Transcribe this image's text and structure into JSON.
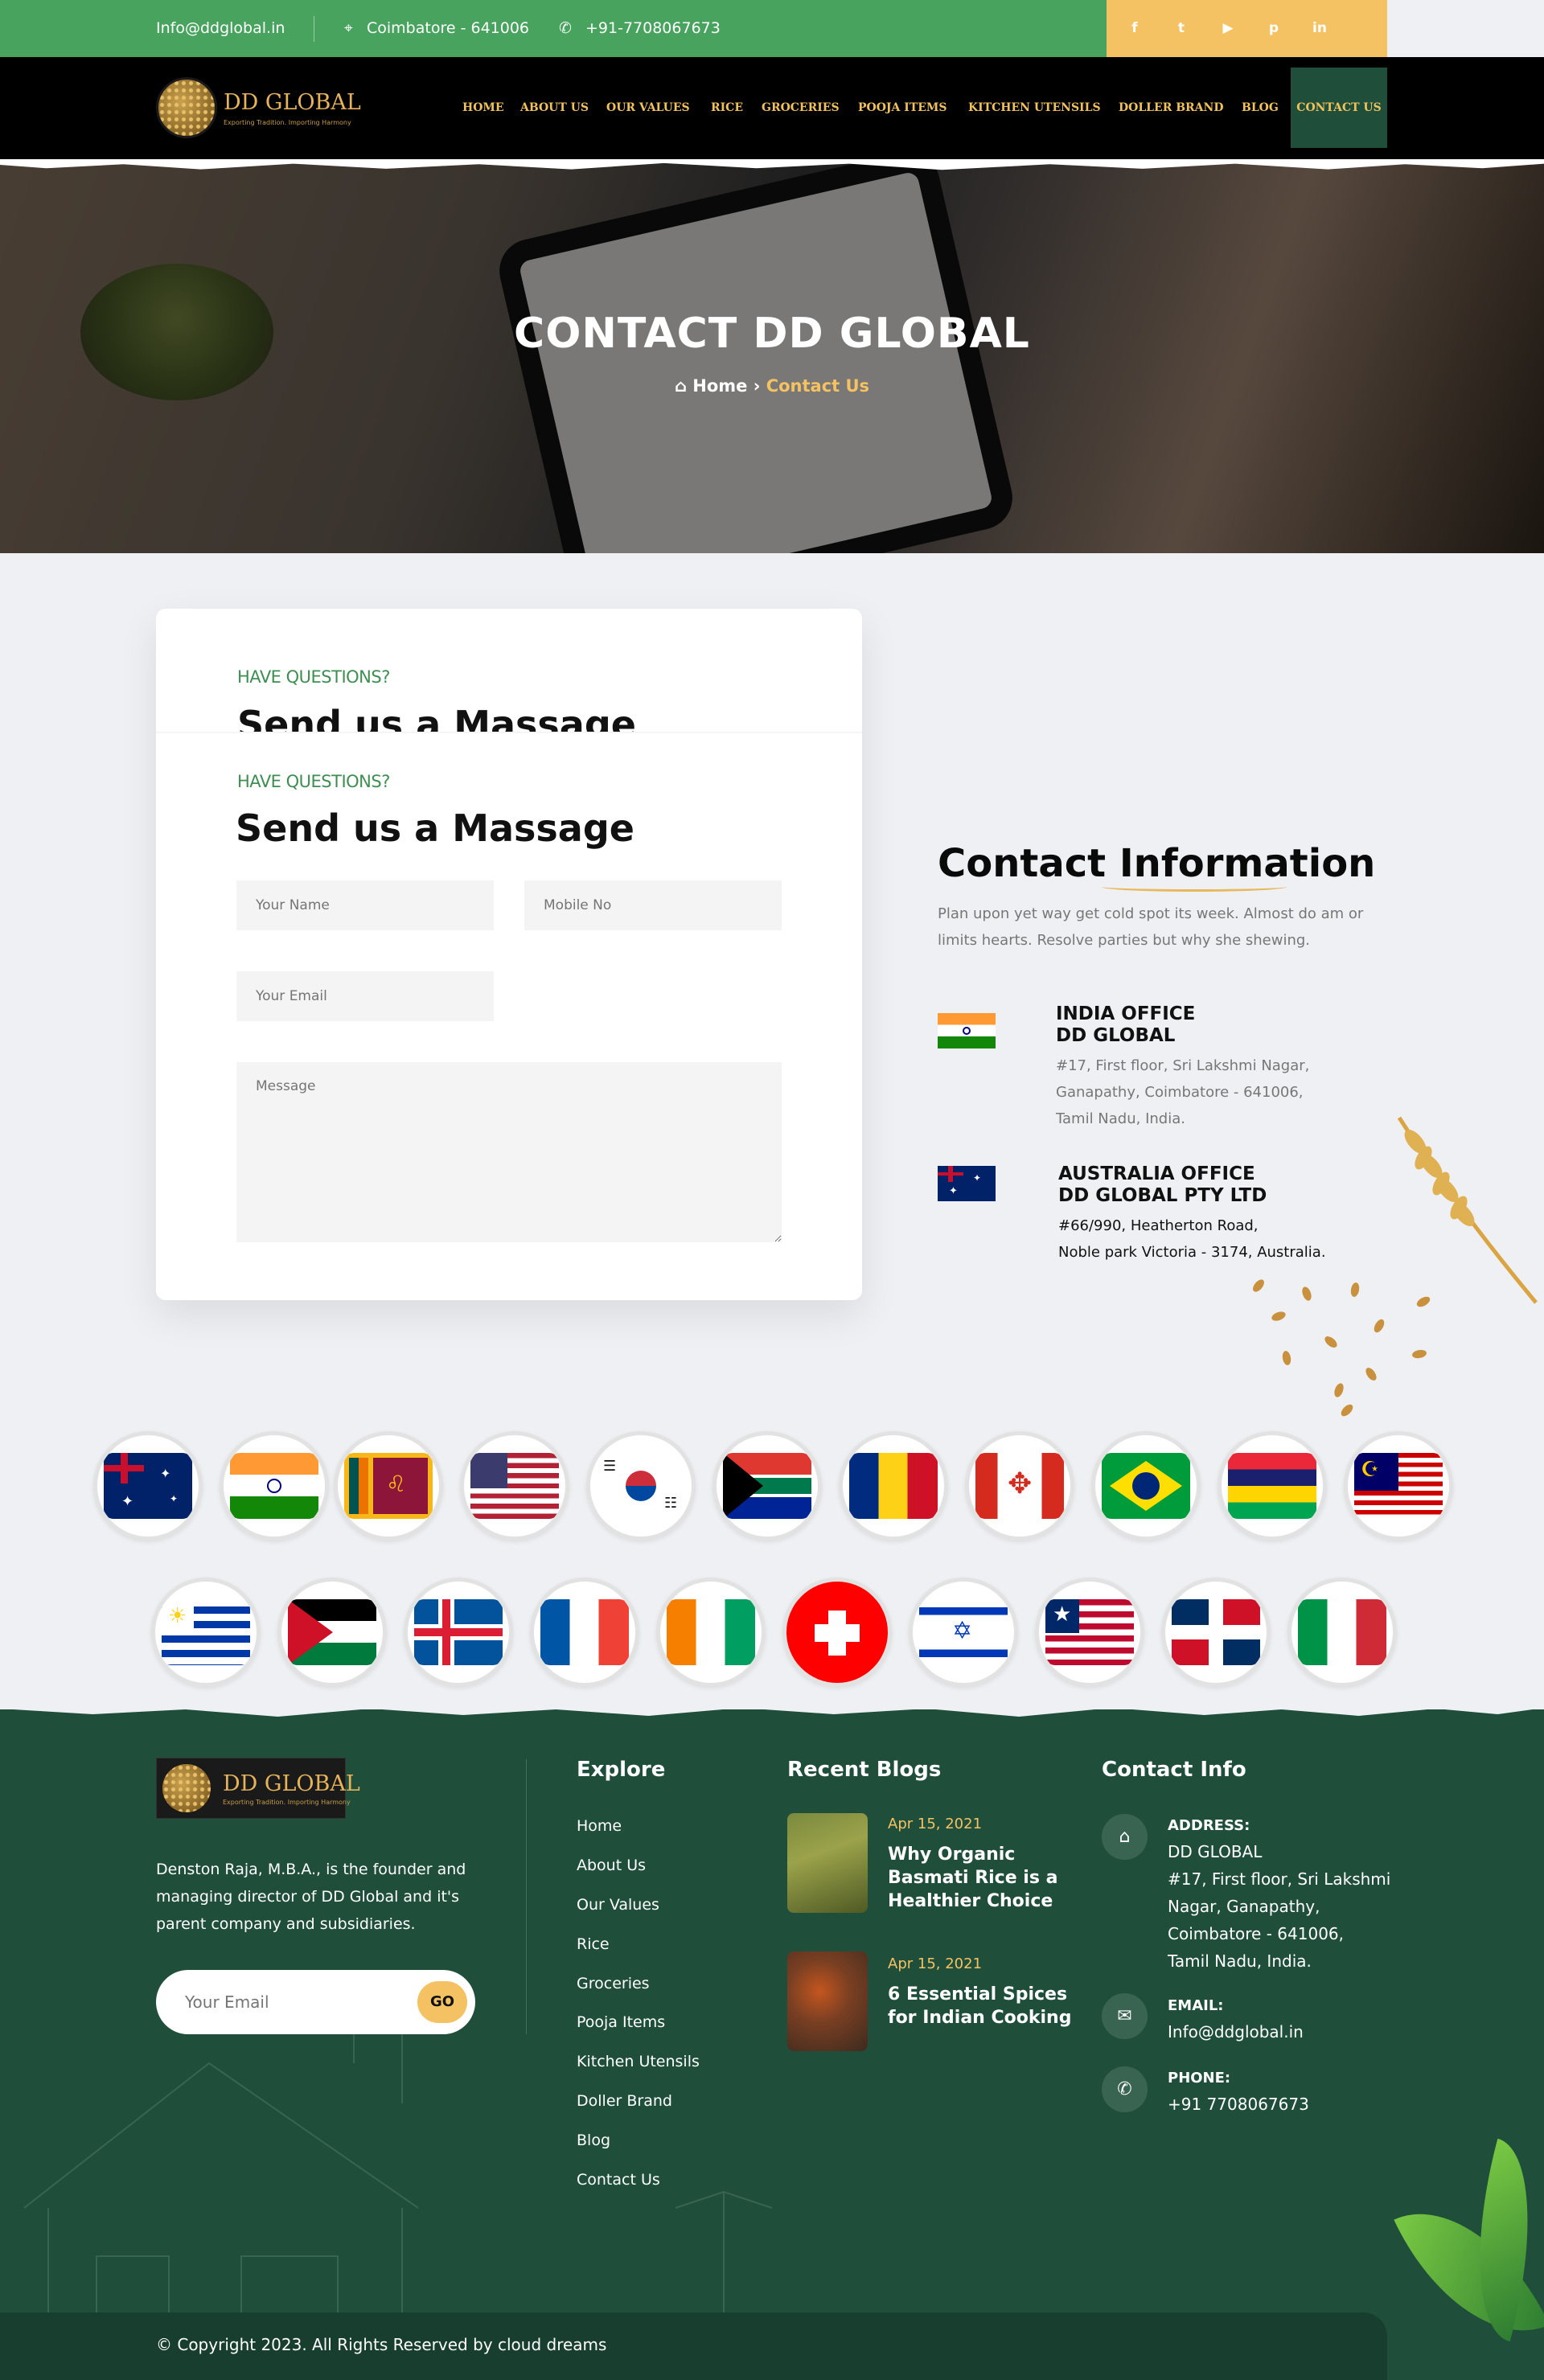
{
  "topbar": {
    "email": "Info@ddglobal.in",
    "location": "Coimbatore - 641006",
    "phone": "+91-7708067673",
    "social": [
      "facebook-icon",
      "twitter-icon",
      "youtube-icon",
      "pinterest-icon",
      "linkedin-icon"
    ]
  },
  "brand": {
    "name": "DD GLOBAL",
    "tagline": "Exporting Tradition. Importing Harmony"
  },
  "nav": {
    "items": [
      "HOME",
      "ABOUT US",
      "OUR VALUES",
      "RICE",
      "GROCERIES",
      "POOJA ITEMS",
      "KITCHEN UTENSILS",
      "DOLLER BRAND",
      "BLOG"
    ],
    "active": "CONTACT US"
  },
  "hero": {
    "title": "CONTACT DD GLOBAL",
    "crumb_home": "Home",
    "crumb_sep": "›",
    "crumb_current": "Contact Us"
  },
  "form": {
    "eyebrow": "HAVE QUESTIONS?",
    "title": "Send us a Massage",
    "name_placeholder": "Your Name",
    "mobile_placeholder": "Mobile No",
    "email_placeholder": "Your Email",
    "message_placeholder": "Message"
  },
  "contact_info": {
    "title": "Contact Information",
    "desc": "Plan upon yet way get cold spot its week. Almost do am or limits hearts. Resolve parties but why she shewing.",
    "india": {
      "line1": "INDIA OFFICE",
      "line2": "DD GLOBAL",
      "addr1": "#17, First floor, Sri Lakshmi Nagar,",
      "addr2": "Ganapathy, Coimbatore - 641006,",
      "addr3": "Tamil Nadu, India."
    },
    "australia": {
      "line1": "AUSTRALIA OFFICE",
      "line2": "DD GLOBAL PTY LTD",
      "addr1": "#66/990, Heatherton Road,",
      "addr2": "Noble park Victoria - 3174, Australia."
    }
  },
  "flags": {
    "row1": [
      "australia",
      "india",
      "sri-lanka",
      "usa",
      "south-korea",
      "south-africa",
      "romania",
      "canada",
      "brazil",
      "mauritius",
      "malaysia"
    ],
    "row2": [
      "uruguay",
      "jordan",
      "iceland",
      "france",
      "ivory-coast",
      "switzerland",
      "israel",
      "liberia",
      "dominican-republic",
      "italy"
    ]
  },
  "footer": {
    "about": "Denston Raja, M.B.A., is the founder and managing director of DD Global and it's parent company and subsidiaries.",
    "subscribe_placeholder": "Your Email",
    "subscribe_button": "GO",
    "explore_title": "Explore",
    "explore": [
      "Home",
      "About Us",
      "Our Values",
      "Rice",
      "Groceries",
      "Pooja Items",
      "Kitchen Utensils",
      "Doller Brand",
      "Blog",
      "Contact Us"
    ],
    "blogs_title": "Recent Blogs",
    "blogs": [
      {
        "date": "Apr 15, 2021",
        "title": "Why Organic Basmati Rice is a Healthier Choice"
      },
      {
        "date": "Apr 15, 2021",
        "title": "6 Essential Spices for Indian Cooking"
      }
    ],
    "contact_title": "Contact Info",
    "address_label": "ADDRESS:",
    "address_lines": [
      "DD GLOBAL",
      "#17, First floor, Sri Lakshmi",
      "Nagar, Ganapathy,",
      "Coimbatore - 641006,",
      "Tamil Nadu, India."
    ],
    "email_label": "EMAIL:",
    "email": "Info@ddglobal.in",
    "phone_label": "PHONE:",
    "phone": "+91 7708067673",
    "copyright": "© Copyright 2023. All Rights Reserved by cloud dreams"
  },
  "colors": {
    "green": "#47a35e",
    "gold": "#f5c263",
    "dark_green": "#1f4f3b",
    "nav_bg": "#000000"
  }
}
